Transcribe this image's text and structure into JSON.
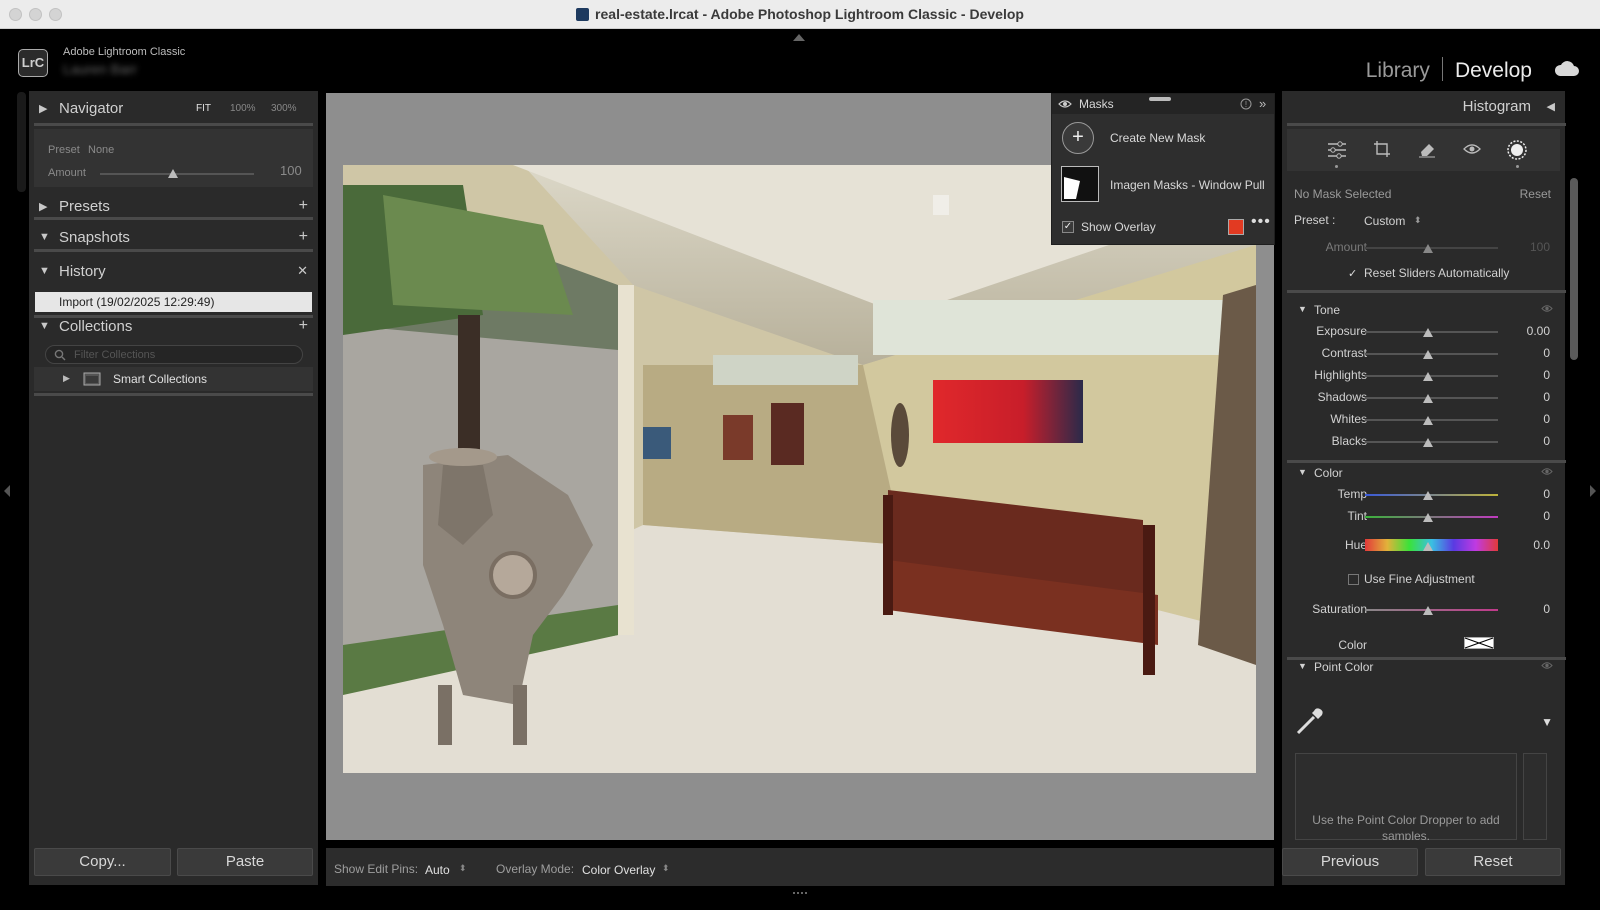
{
  "window": {
    "title": "real-estate.lrcat - Adobe Photoshop Lightroom Classic - Develop"
  },
  "brand": {
    "app_name": "Adobe Lightroom Classic",
    "user_name": "Lauren Barr",
    "logo_text": "LrC"
  },
  "modules": {
    "library": "Library",
    "develop": "Develop"
  },
  "left": {
    "navigator": {
      "title": "Navigator",
      "fit": "FIT",
      "z100": "100%",
      "z300": "300%"
    },
    "preset_strip": {
      "preset_label": "Preset",
      "preset_value": "None",
      "amount_label": "Amount",
      "amount_value": "100"
    },
    "presets": {
      "title": "Presets"
    },
    "snapshots": {
      "title": "Snapshots"
    },
    "history": {
      "title": "History",
      "items": [
        "Import (19/02/2025 12:29:49)"
      ]
    },
    "collections": {
      "title": "Collections",
      "filter_placeholder": "Filter Collections",
      "smart": "Smart Collections"
    },
    "copy_btn": "Copy...",
    "paste_btn": "Paste"
  },
  "toolbar": {
    "edit_pins_label": "Show Edit Pins:",
    "edit_pins_value": "Auto",
    "overlay_label": "Overlay Mode:",
    "overlay_value": "Color Overlay"
  },
  "masks": {
    "title": "Masks",
    "create": "Create New Mask",
    "mask_name": "Imagen Masks - Window Pull",
    "show_overlay": "Show Overlay",
    "overlay_color": "#e23a22"
  },
  "right": {
    "histogram": "Histogram",
    "no_mask": "No Mask Selected",
    "reset_link": "Reset",
    "preset_label": "Preset :",
    "preset_value": "Custom",
    "amount_label": "Amount",
    "amount_value": "100",
    "reset_auto": "Reset Sliders Automatically",
    "tone": {
      "title": "Tone",
      "sliders": [
        {
          "label": "Exposure",
          "value": "0.00"
        },
        {
          "label": "Contrast",
          "value": "0"
        },
        {
          "label": "Highlights",
          "value": "0"
        },
        {
          "label": "Shadows",
          "value": "0"
        },
        {
          "label": "Whites",
          "value": "0"
        },
        {
          "label": "Blacks",
          "value": "0"
        }
      ]
    },
    "color": {
      "title": "Color",
      "temp": {
        "label": "Temp",
        "value": "0"
      },
      "tint": {
        "label": "Tint",
        "value": "0"
      },
      "hue": {
        "label": "Hue",
        "value": "0.0"
      },
      "fine": "Use Fine Adjustment",
      "saturation": {
        "label": "Saturation",
        "value": "0"
      },
      "color_label": "Color"
    },
    "point_color": {
      "title": "Point Color",
      "hint": "Use the Point Color Dropper to add samples."
    },
    "previous_btn": "Previous",
    "reset_btn": "Reset"
  },
  "colors": {
    "accent_red": "#e23a22",
    "panel_bg": "#2a2a2a",
    "canvas_bg": "#8e8e8e"
  }
}
